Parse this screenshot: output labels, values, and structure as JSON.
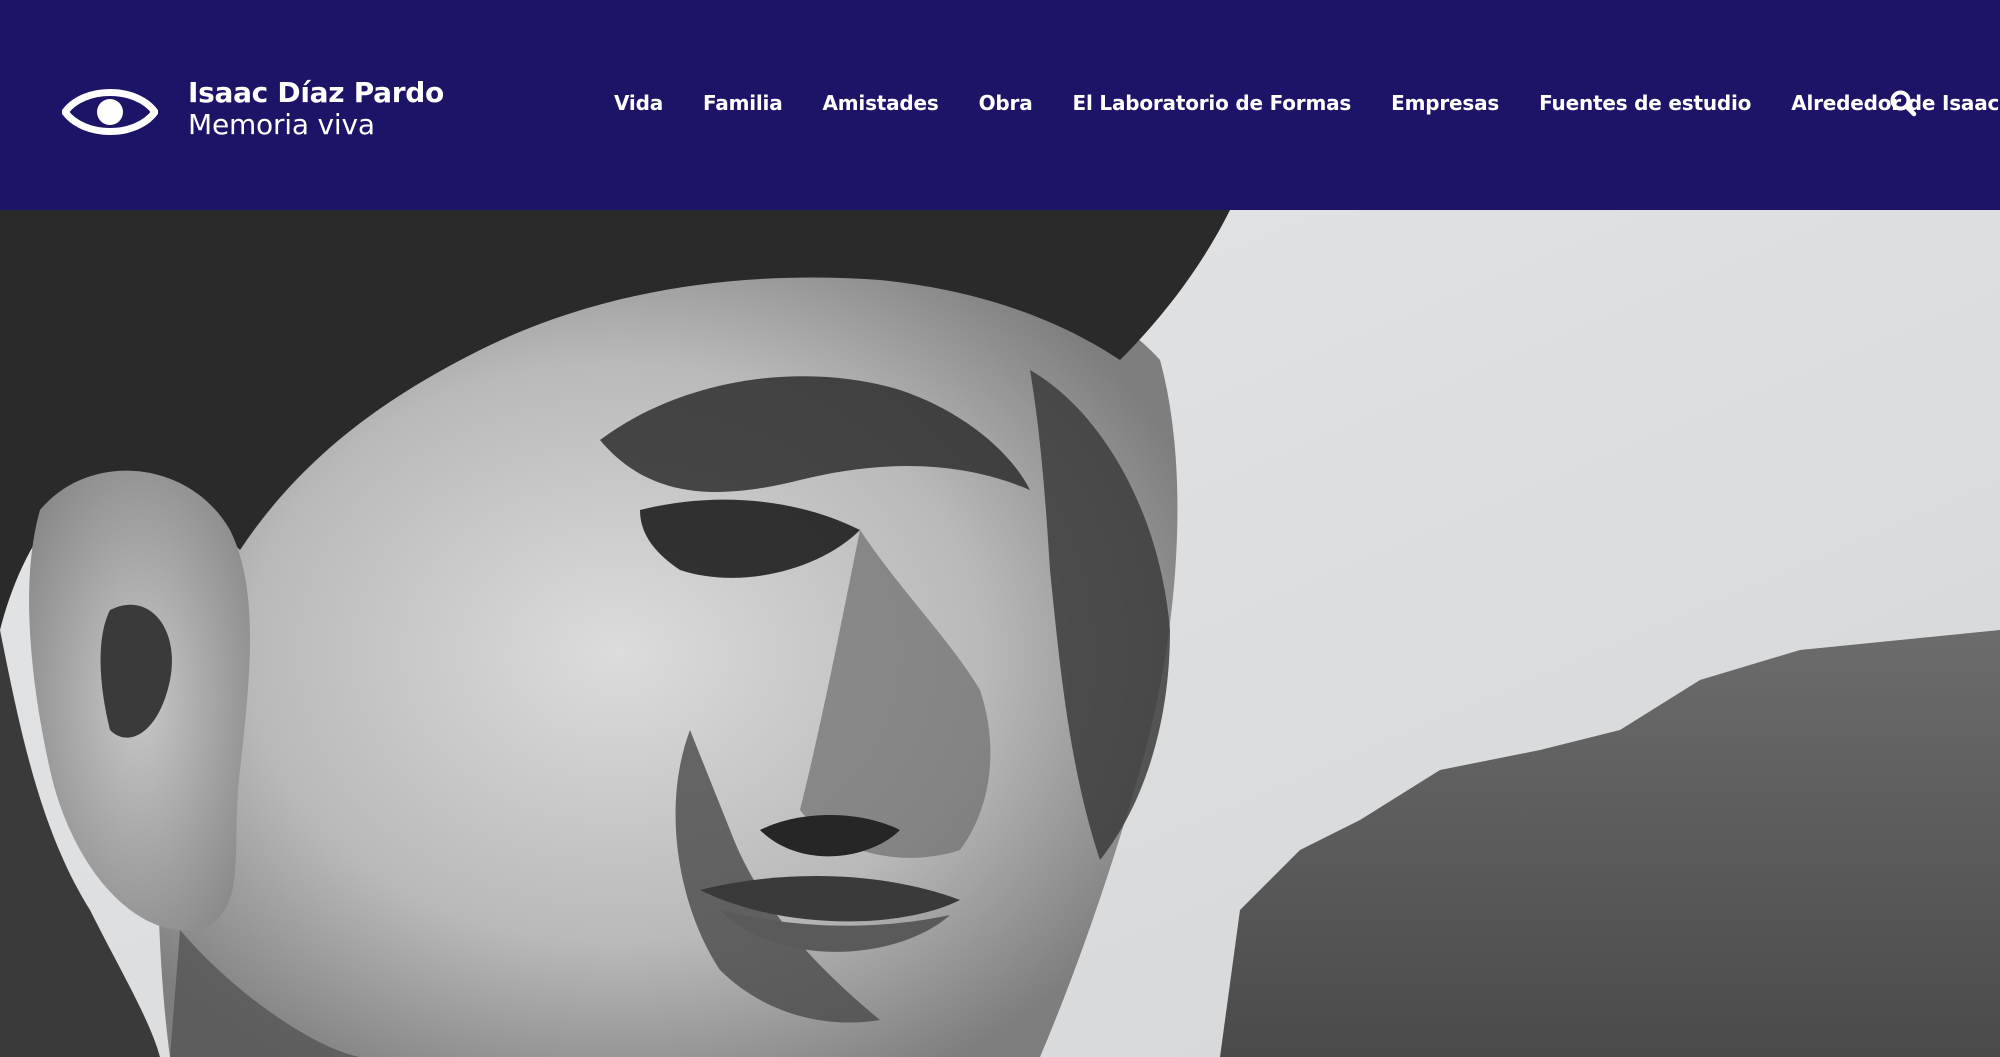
{
  "header": {
    "background_color": "#1c1466",
    "brand": {
      "logo_icon": "eye-icon",
      "title": "Isaac Díaz Pardo",
      "subtitle": "Memoria viva"
    },
    "nav": {
      "items": [
        {
          "label": "Vida"
        },
        {
          "label": "Familia"
        },
        {
          "label": "Amistades"
        },
        {
          "label": "Obra"
        },
        {
          "label": "El Laboratorio de Formas"
        },
        {
          "label": "Empresas"
        },
        {
          "label": "Fuentes de estudio"
        },
        {
          "label": "Alrededor de Isaac"
        }
      ],
      "search_icon": "search-icon"
    }
  },
  "hero": {
    "image": "black-and-white close-up portrait photograph"
  }
}
